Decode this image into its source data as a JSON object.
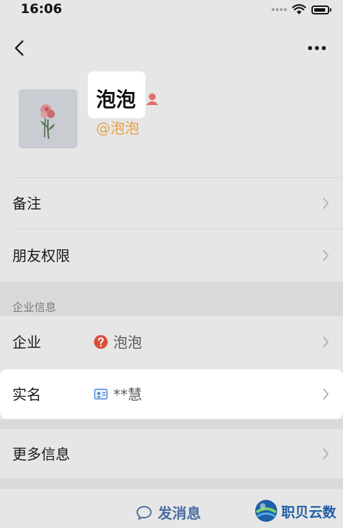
{
  "status_bar": {
    "time": "16:06"
  },
  "profile": {
    "name": "泡泡",
    "wecom_id": "@泡泡"
  },
  "rows": {
    "remark": {
      "label": "备注"
    },
    "friend_permission": {
      "label": "朋友权限"
    },
    "company": {
      "label": "企业",
      "value": "泡泡"
    },
    "real_name": {
      "label": "实名",
      "value": "**慧"
    },
    "more_info": {
      "label": "更多信息"
    }
  },
  "section": {
    "enterprise_info_title": "企业信息"
  },
  "bottom": {
    "send_message_label": "发消息"
  },
  "watermark": {
    "text": "职贝云数"
  },
  "colors": {
    "background": "#e6e6e6",
    "highlight": "#ffffff",
    "wecom_id": "#e6a04a",
    "gender_icon": "#e36c6c",
    "unverified_icon": "#d9503a",
    "send_message": "#4a6da0",
    "watermark": "#1f5fa8"
  },
  "icons": {
    "back": "chevron-left-icon",
    "more": "more-dots-icon",
    "gender": "female-person-icon",
    "company_status": "question-circle-icon",
    "real_name": "id-card-icon",
    "send": "chat-bubble-icon",
    "row_arrow": "chevron-right-icon"
  }
}
